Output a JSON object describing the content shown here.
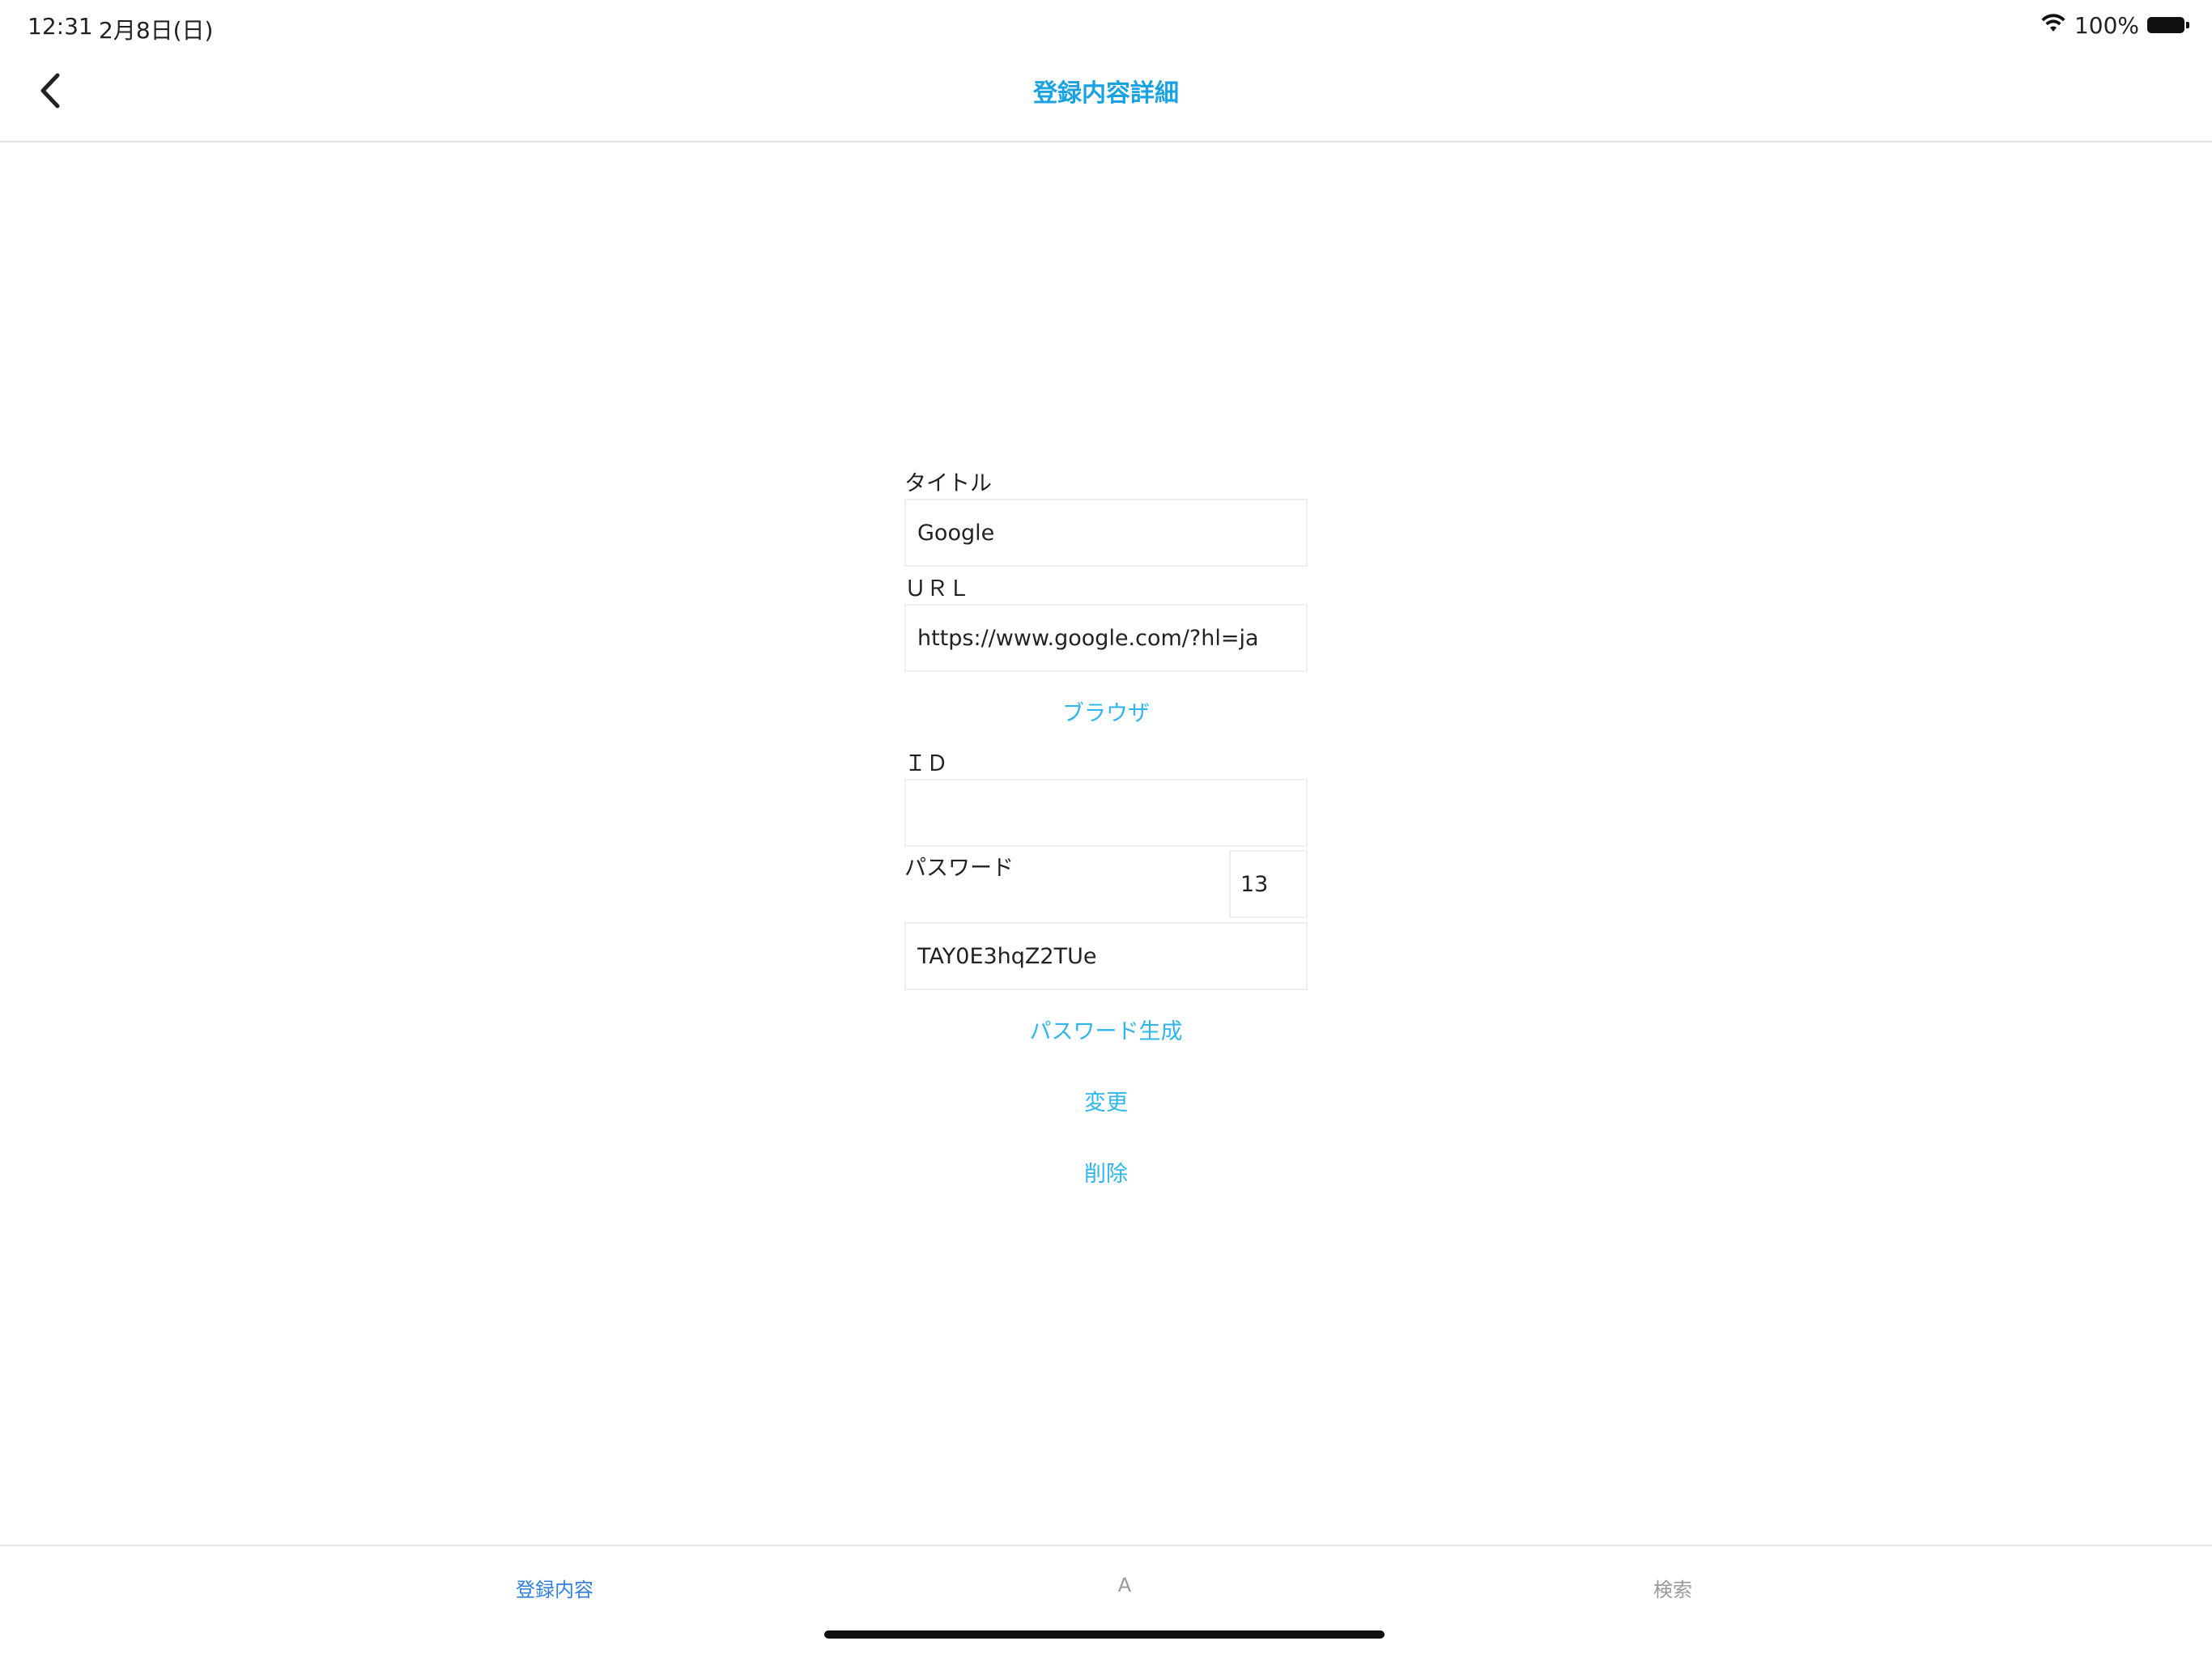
{
  "status_bar": {
    "time": "12:31",
    "date": "2月8日(日)",
    "battery": "100%"
  },
  "nav": {
    "title": "登録内容詳細"
  },
  "form": {
    "title_label": "タイトル",
    "title_value": "Google",
    "url_label": "ＵＲＬ",
    "url_value": "https://www.google.com/?hl=ja",
    "browser_button": "ブラウザ",
    "id_label": "ＩＤ",
    "id_value": "",
    "password_label": "パスワード",
    "password_length": "13",
    "password_value": "TAY0E3hqZ2TUe",
    "generate_button": "パスワード生成",
    "update_button": "変更",
    "delete_button": "削除"
  },
  "tabs": [
    {
      "label": "登録内容"
    },
    {
      "label": "A"
    },
    {
      "label": "検索"
    }
  ],
  "colors": {
    "accent": "#1aa3e0",
    "tab_active": "#2f7fe0",
    "tab_inactive": "#9a9a9a"
  }
}
